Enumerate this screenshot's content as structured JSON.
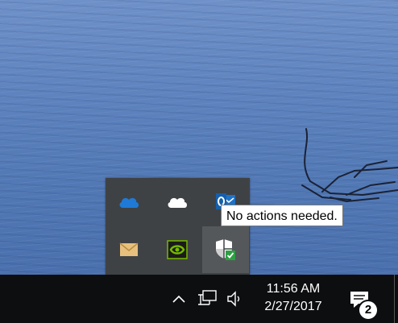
{
  "tray_overflow": {
    "icons": [
      {
        "name": "onedrive-blue-icon"
      },
      {
        "name": "onedrive-white-icon"
      },
      {
        "name": "outlook-icon"
      },
      {
        "name": "mail-icon"
      },
      {
        "name": "nvidia-icon"
      },
      {
        "name": "windows-defender-icon"
      }
    ]
  },
  "tooltip": {
    "text": "No actions needed."
  },
  "taskbar": {
    "clock_time": "11:56 AM",
    "clock_date": "2/27/2017",
    "notification_count": "2"
  },
  "colors": {
    "taskbar_bg": "#0d0e10",
    "tray_bg": "#3f4245",
    "onedrive_blue": "#1e7ad6",
    "outlook_blue": "#1f73c7",
    "nvidia_green": "#76b900",
    "defender_green": "#2ea043",
    "mail_tan": "#e8c07d"
  }
}
